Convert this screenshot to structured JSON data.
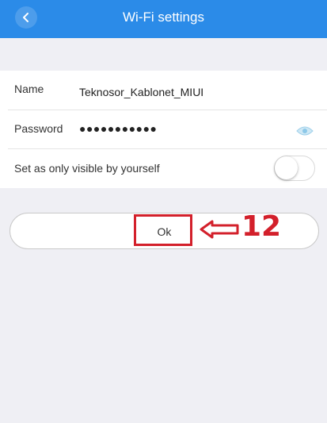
{
  "header": {
    "title": "Wi-Fi settings",
    "background": "#2b8be8"
  },
  "form": {
    "name_label": "Name",
    "name_value": "Teknosor_Kablonet_MIUI",
    "password_label": "Password",
    "password_value": "●●●●●●●●●●●",
    "visibility_label": "Set as only visible by yourself",
    "visibility_on": false
  },
  "ok_button": {
    "label": "Ok"
  },
  "annotation": {
    "number": "12",
    "color": "#d3202b"
  }
}
